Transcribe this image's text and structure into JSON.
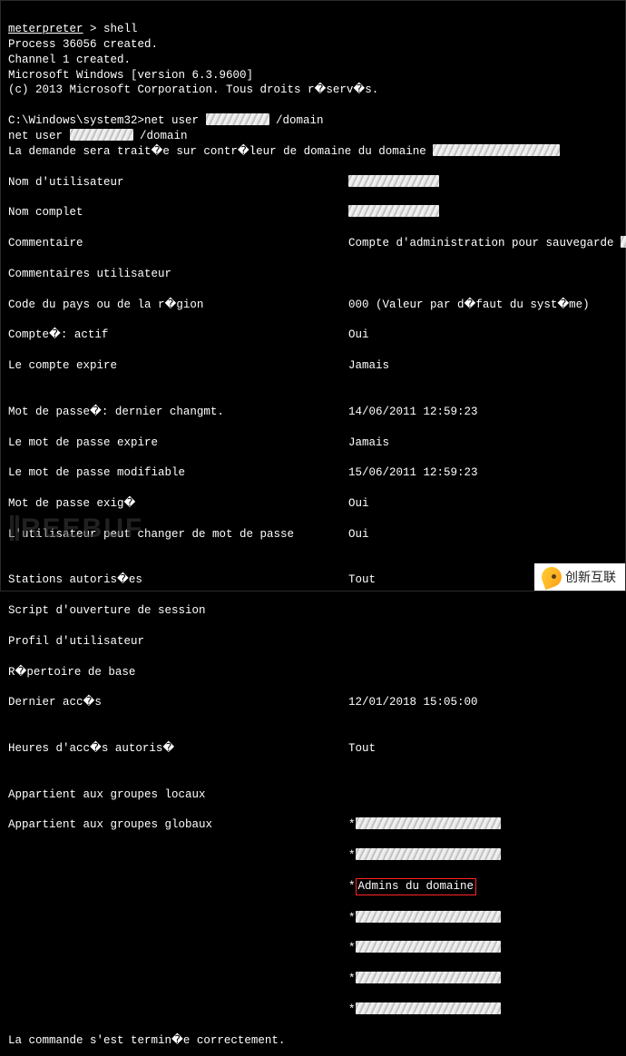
{
  "header": {
    "meterpreter_label": "meterpreter",
    "prompt_arrow": " > ",
    "shell_cmd": "shell",
    "process_line": "Process 36056 created.",
    "channel_line": "Channel 1 created.",
    "winver_line": "Microsoft Windows [version 6.3.9600]",
    "copyright_line": "(c) 2013 Microsoft Corporation. Tous droits r�serv�s."
  },
  "cmd": {
    "prompt": "C:\\Windows\\system32>",
    "command_prefix": "net user ",
    "command_suffix": " /domain",
    "echo_prefix": "net user ",
    "echo_suffix": " /domain",
    "forwarded_prefix": "La demande sera trait�e sur contr�leur de domaine du domaine "
  },
  "fields": {
    "username_label": "Nom d'utilisateur",
    "fullname_label": "Nom complet",
    "comment_label": "Commentaire",
    "comment_value": "Compte d'administration pour sauvegarde ",
    "usercomment_label": "Commentaires utilisateur",
    "countrycode_label": "Code du pays ou de la r�gion",
    "countrycode_value": "000 (Valeur par d�faut du syst�me)",
    "active_label": "Compte�: actif",
    "active_value": "Oui",
    "expires_label": "Le compte expire",
    "expires_value": "Jamais",
    "pwdlast_label": "Mot de passe�: dernier changmt.",
    "pwdlast_value": "14/06/2011 12:59:23",
    "pwdexpires_label": "Le mot de passe expire",
    "pwdexpires_value": "Jamais",
    "pwdchange_label": "Le mot de passe modifiable",
    "pwdchange_value": "15/06/2011 12:59:23",
    "pwdreq_label": "Mot de passe exig�",
    "pwdreq_value": "Oui",
    "pwdcanchange_label": "L'utilisateur peut changer de mot de passe",
    "pwdcanchange_value": "Oui",
    "workstations_label": "Stations autoris�es",
    "workstations_value": "Tout",
    "logonscript_label": "Script d'ouverture de session",
    "profile_label": "Profil d'utilisateur",
    "homedir_label": "R�pertoire de base",
    "lastlogon_label": "Dernier acc�s",
    "lastlogon_value": "12/01/2018 15:05:00",
    "logonhours_label": "Heures d'acc�s autoris�",
    "logonhours_value": "Tout",
    "localgroups_label": "Appartient aux groupes locaux",
    "globalgroups_label": "Appartient aux groupes globaux",
    "star": "*",
    "admins_du_domaine": "Admins du domaine",
    "success_line": "La commande s'est termin�e correctement."
  },
  "watermark": "REEBUF",
  "brand_text": "创新互联"
}
